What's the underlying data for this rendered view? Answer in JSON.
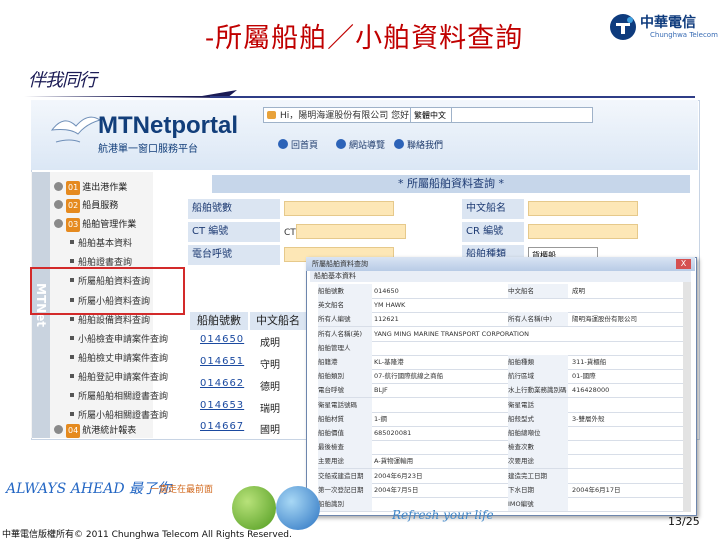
{
  "slide": {
    "title": "-所屬船舶／小舶資料查詢",
    "brand": "中華電信",
    "brand_sub": "Chunghwa Telecom",
    "script_logo": "伴我同行"
  },
  "portal": {
    "logo": "MTNetportal",
    "subtitle": "航港單一窗口服務平台",
    "address_text": "Hi，陽明海運股份有限公司 您好",
    "lang_value": "繁體中文",
    "topnav": [
      "回首頁",
      "網站導覽",
      "聯絡我們"
    ],
    "vertical_brand": "MTNet"
  },
  "sidebar": {
    "items": [
      {
        "num": "01",
        "label": "進出港作業"
      },
      {
        "num": "02",
        "label": "船員服務"
      },
      {
        "num": "03",
        "label": "船舶管理作業"
      }
    ],
    "subitems": [
      "船舶基本資料",
      "船舶證書查詢",
      "所屬船舶資料查詢",
      "所屬小船資料查詢",
      "船舶設備資料查詢",
      "小船檢查申請案件查詢",
      "船舶檢丈申請案件查詢",
      "船舶登記申請案件查詢",
      "所屬船舶相關證書查詢",
      "所屬小船相關證書查詢"
    ],
    "last_item": {
      "num": "04",
      "label": "航港統計報表"
    }
  },
  "query": {
    "title": "* 所屬船舶資料查詢 *",
    "labels": [
      "船舶號數",
      "CT 編號",
      "電台呼號",
      "中文船名",
      "CR 編號",
      "船舶種類"
    ],
    "ct_prefix": "CT",
    "type_value": "貨櫃船"
  },
  "results": {
    "headers": [
      "船舶號數",
      "中文船名"
    ],
    "rows": [
      {
        "no": "014650",
        "name": "成明"
      },
      {
        "no": "014651",
        "name": "守明"
      },
      {
        "no": "014662",
        "name": "德明"
      },
      {
        "no": "014653",
        "name": "瑞明"
      },
      {
        "no": "014667",
        "name": "國明"
      }
    ]
  },
  "popup": {
    "window_title": "所屬船舶資料查詢",
    "subtitle": "船舶基本資料",
    "close": "X",
    "rows": [
      {
        "l1": "船舶號數",
        "v1": "014650",
        "l2": "中文船名",
        "v2": "成明"
      },
      {
        "l1": "英文船名",
        "v1": "YM HAWK",
        "l2": "",
        "v2": ""
      },
      {
        "l1": "所有人編號",
        "v1": "112621",
        "l2": "所有人名稱(中)",
        "v2": "陽明海運股份有限公司"
      },
      {
        "l1": "所有人名稱(英)",
        "v1": "YANG MING MARINE TRANSPORT CORPORATION",
        "l2": "",
        "v2": ""
      },
      {
        "l1": "船舶管理人",
        "v1": "",
        "l2": "",
        "v2": ""
      },
      {
        "l1": "船籍港",
        "v1": "KL-基隆港",
        "l2": "船舶種類",
        "v2": "311-貨櫃船"
      },
      {
        "l1": "船舶類別",
        "v1": "07-航行國際航線之商船",
        "l2": "航行區域",
        "v2": "01-國際"
      },
      {
        "l1": "電台呼號",
        "v1": "BLJF",
        "l2": "水上行動業務識別碼",
        "v2": "416428000"
      },
      {
        "l1": "衛星電話號碼",
        "v1": "",
        "l2": "衛星電話",
        "v2": ""
      },
      {
        "l1": "船舶材質",
        "v1": "1-鋼",
        "l2": "船殼型式",
        "v2": "3-雙層外殼"
      },
      {
        "l1": "船舶價值",
        "v1": "685020081",
        "l2": "船舶總噸位",
        "v2": ""
      },
      {
        "l1": "最後檢查",
        "v1": "",
        "l2": "檢查次數",
        "v2": ""
      },
      {
        "l1": "主要用途",
        "v1": "A-貨物運輸用",
        "l2": "次要用途",
        "v2": ""
      },
      {
        "l1": "交船或建造日期",
        "v1": "2004年6月23日",
        "l2": "建造完工日期",
        "v2": ""
      },
      {
        "l1": "第一次登記日期",
        "v1": "2004年7月5日",
        "l2": "下水日期",
        "v2": "2004年6月17日"
      },
      {
        "l1": "船舶識別",
        "v1": "",
        "l2": "IMO編號",
        "v2": ""
      }
    ]
  },
  "footer": {
    "slogan": "ALWAYS AHEAD 最了你",
    "slogan_sub": "一直走在最前面",
    "refresh": "Refresh your life",
    "copyright": "中華電信版權所有© 2011 Chunghwa Telecom All Rights Reserved.",
    "page": "13/25"
  },
  "colors": {
    "title_red": "#c00000",
    "nav_blue": "#1e3b73",
    "highlight_red": "#d32a2a",
    "input_yellow": "#fde7b6"
  }
}
